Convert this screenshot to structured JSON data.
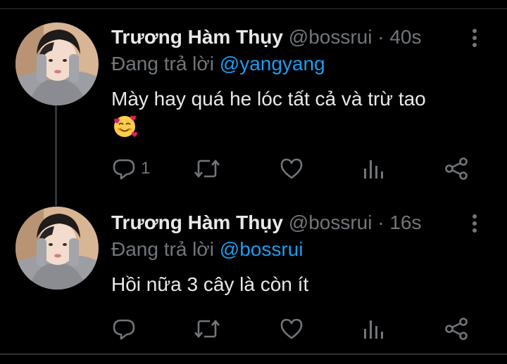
{
  "tweets": [
    {
      "name": "Trương Hàm Thụy",
      "handle": "@bossrui",
      "separator": "·",
      "time": "40s",
      "reply_prefix": "Đang trả lời",
      "reply_to": "@yangyang",
      "text": "Mày hay quá he lóc tất cả và trừ tao",
      "emoji": "smiling-face-with-hearts",
      "reply_count": "1"
    },
    {
      "name": "Trương Hàm Thụy",
      "handle": "@bossrui",
      "separator": "·",
      "time": "16s",
      "reply_prefix": "Đang trả lời",
      "reply_to": "@bossrui",
      "text": "Hồi nữa 3 cây là còn ít",
      "reply_count": ""
    }
  ],
  "colors": {
    "background": "#000000",
    "text": "#e7e9ea",
    "muted": "#71767b",
    "accent": "#1d9bf0",
    "divider": "#2f3336"
  },
  "icons": [
    "more-vertical-icon",
    "reply-icon",
    "retweet-icon",
    "like-icon",
    "views-icon",
    "share-icon"
  ]
}
